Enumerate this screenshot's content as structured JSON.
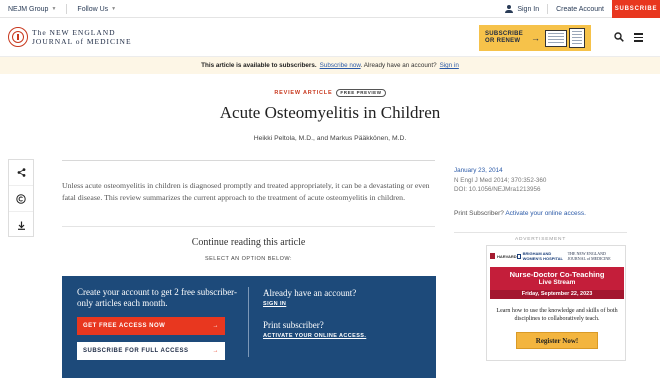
{
  "topbar": {
    "nejm_group": "NEJM Group",
    "follow_us": "Follow Us",
    "sign_in": "Sign In",
    "create_account": "Create Account",
    "subscribe": "SUBSCRIBE"
  },
  "masthead": {
    "logo_line1": "The NEW ENGLAND",
    "logo_line2": "JOURNAL of MEDICINE",
    "promo_line1": "SUBSCRIBE",
    "promo_line2": "OR RENEW",
    "promo_arrow": "→"
  },
  "notice": {
    "text": "This article is available to subscribers.",
    "subscribe_link": "Subscribe now",
    "middle": ". Already have an account?",
    "signin_link": "Sign in"
  },
  "article": {
    "label": "REVIEW ARTICLE",
    "badge": "FREE PREVIEW",
    "title": "Acute Osteomyelitis in Children",
    "authors": "Heikki Peltola, M.D., and Markus Pääkkönen, M.D.",
    "abstract": "Unless acute osteomyelitis in children is diagnosed promptly and treated appropriately, it can be a devastating or even fatal disease. This review summarizes the current approach to the treatment of acute osteomyelitis in children.",
    "continue_heading": "Continue reading this article",
    "select_option": "SELECT AN OPTION BELOW:"
  },
  "meta": {
    "date": "January 23, 2014",
    "citation": "N Engl J Med 2014; 370:352-360",
    "doi": "DOI: 10.1056/NEJMra1213956",
    "print_text": "Print Subscriber?",
    "print_link": "Activate your online access."
  },
  "panel": {
    "create_heading": "Create your account to get 2 free subscriber-only articles each month.",
    "free_button": "GET FREE ACCESS NOW",
    "subscribe_button": "SUBSCRIBE FOR FULL ACCESS",
    "arrow": "→",
    "have_account": "Already have an account?",
    "signin": "SIGN IN",
    "print_subscriber": "Print subscriber?",
    "activate": "ACTIVATE YOUR ONLINE ACCESS."
  },
  "ad": {
    "label": "ADVERTISEMENT",
    "logo_harvard": "HARVARD",
    "logo_bwh": "BRIGHAM AND WOMEN'S HOSPITAL",
    "logo_nejm": "THE NEW ENGLAND JOURNAL of MEDICINE",
    "headline": "Nurse-Doctor Co-Teaching",
    "subhead": "Live Stream",
    "date": "Friday, September 22, 2023",
    "body": "Learn how to use the knowledge and skills of both disciplines to collaboratively teach.",
    "button": "Register Now!"
  },
  "colors": {
    "accent_red": "#e8371f",
    "navy": "#1d4a7a",
    "promo_yellow": "#f6c24a",
    "link_blue": "#2b5aa8"
  },
  "icons": [
    "user-icon",
    "search-icon",
    "menu-icon",
    "share-icon",
    "copyright-icon",
    "download-icon",
    "arrow-right-icon",
    "nejm-seal-logo"
  ]
}
